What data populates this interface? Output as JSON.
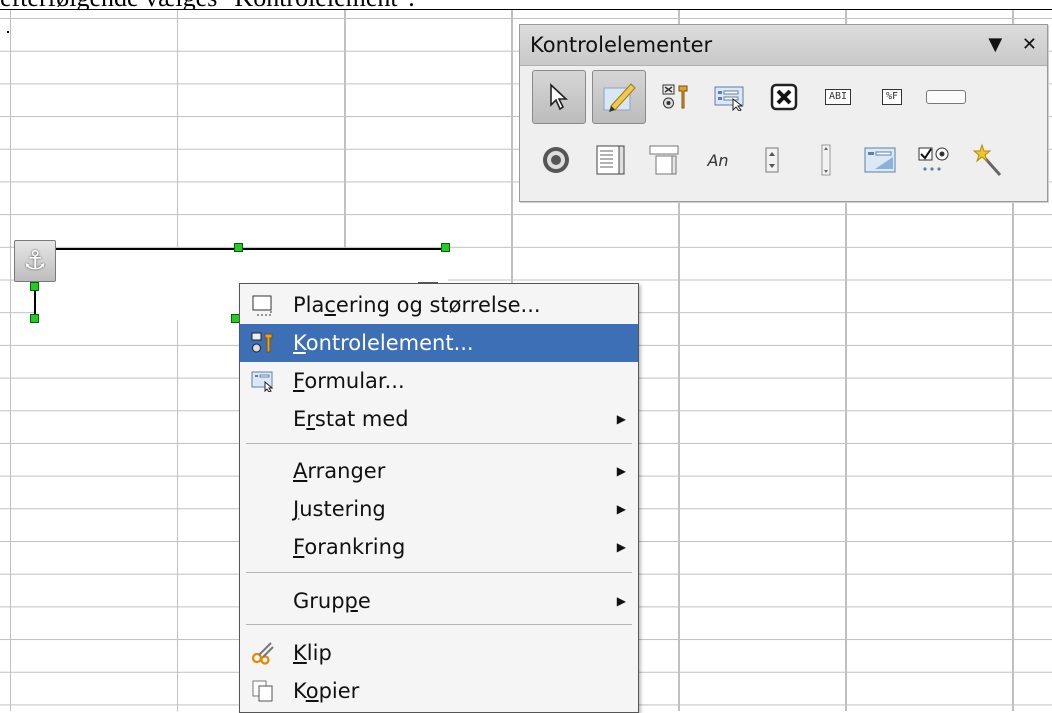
{
  "caption": {
    "text": "efterfølgende vælges \"Kontrolelement\"."
  },
  "toolbar": {
    "title": "Kontrolelementer",
    "dropdown_icon": "triangle-down-icon",
    "close_icon": "close-icon",
    "row1": [
      "select-icon",
      "design-mode-icon",
      "control-properties-icon",
      "form-properties-icon",
      "checkbox-x-icon",
      "text-box-icon",
      "formatted-field-icon",
      "push-button-icon"
    ],
    "row2": [
      "option-button-icon",
      "list-box-icon",
      "combo-box-icon",
      "label-field-icon",
      "spin-button-icon",
      "scrollbar-icon",
      "form-design-icon",
      "group-box-icon",
      "wizard-icon"
    ],
    "row1_labels": {
      "text_box": "ABI",
      "formatted": "%F"
    },
    "row2_labels": {
      "label_field": "An"
    }
  },
  "context_menu": {
    "items": [
      {
        "pre": "Pla",
        "u": "c",
        "post": "ering og størrelse...",
        "icon": "position-size-icon",
        "submenu": false
      },
      {
        "pre": "",
        "u": "K",
        "post": "ontrolelement...",
        "icon": "control-properties-icon",
        "submenu": false,
        "active": true
      },
      {
        "pre": "",
        "u": "F",
        "post": "ormular...",
        "icon": "form-icon",
        "submenu": false
      },
      {
        "pre": "E",
        "u": "r",
        "post": "stat med",
        "icon": "",
        "submenu": true
      },
      {
        "pre": "",
        "u": "A",
        "post": "rranger",
        "icon": "",
        "submenu": true
      },
      {
        "pre": "",
        "u": "J",
        "post": "ustering",
        "icon": "",
        "submenu": true
      },
      {
        "pre": "",
        "u": "F",
        "post": "orankring",
        "icon": "",
        "submenu": true
      },
      {
        "pre": "Grup",
        "u": "p",
        "post": "e",
        "icon": "",
        "submenu": true
      },
      {
        "pre": "",
        "u": "K",
        "post": "lip",
        "icon": "scissors-icon",
        "submenu": false
      },
      {
        "pre": "K",
        "u": "o",
        "post": "pier",
        "icon": "copy-icon",
        "submenu": false
      }
    ]
  },
  "colors": {
    "highlight": "#3d6fb6",
    "handle": "#22cc22",
    "grid": "#c0c0c0"
  }
}
